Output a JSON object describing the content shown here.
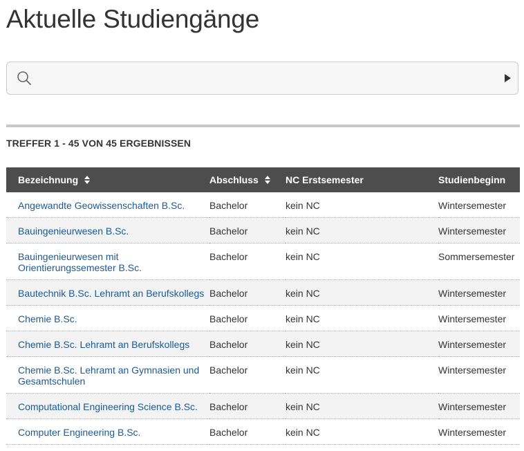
{
  "page": {
    "title": "Aktuelle Studiengänge"
  },
  "search": {
    "placeholder": "",
    "value": "",
    "icon": "search-icon",
    "submit_icon": "triangle-right-icon"
  },
  "results": {
    "summary": "TREFFER 1 - 45 VON 45 ERGEBNISSEN",
    "columns": [
      {
        "label": "Bezeichnung",
        "sortable": true
      },
      {
        "label": "Abschluss",
        "sortable": true
      },
      {
        "label": "NC Erstsemester",
        "sortable": false
      },
      {
        "label": "Studienbeginn",
        "sortable": false
      }
    ],
    "rows": [
      {
        "name": "Angewandte Geowissenschaften B.Sc.",
        "degree": "Bachelor",
        "nc": "kein NC",
        "start": "Wintersemester"
      },
      {
        "name": "Bauingenieurwesen B.Sc.",
        "degree": "Bachelor",
        "nc": "kein NC",
        "start": "Wintersemester"
      },
      {
        "name": "Bauingenieurwesen mit Orientierungssemester B.Sc.",
        "degree": "Bachelor",
        "nc": "kein NC",
        "start": "Sommersemester"
      },
      {
        "name": "Bautechnik B.Sc. Lehramt an Berufskollegs",
        "degree": "Bachelor",
        "nc": "kein NC",
        "start": "Wintersemester"
      },
      {
        "name": "Chemie B.Sc.",
        "degree": "Bachelor",
        "nc": "kein NC",
        "start": "Wintersemester"
      },
      {
        "name": "Chemie B.Sc. Lehramt an Berufskollegs",
        "degree": "Bachelor",
        "nc": "kein NC",
        "start": "Wintersemester"
      },
      {
        "name": "Chemie B.Sc. Lehramt an Gymnasien und Gesamtschulen",
        "degree": "Bachelor",
        "nc": "kein NC",
        "start": "Wintersemester"
      },
      {
        "name": "Computational Engineering Science B.Sc.",
        "degree": "Bachelor",
        "nc": "kein NC",
        "start": "Wintersemester"
      },
      {
        "name": "Computer Engineering B.Sc.",
        "degree": "Bachelor",
        "nc": "kein NC",
        "start": "Wintersemester"
      }
    ]
  },
  "colors": {
    "header_bg": "#4d4d4d",
    "link": "#1a5a96",
    "stripe": "#f3f3f3",
    "divider": "#c8c8c8"
  }
}
